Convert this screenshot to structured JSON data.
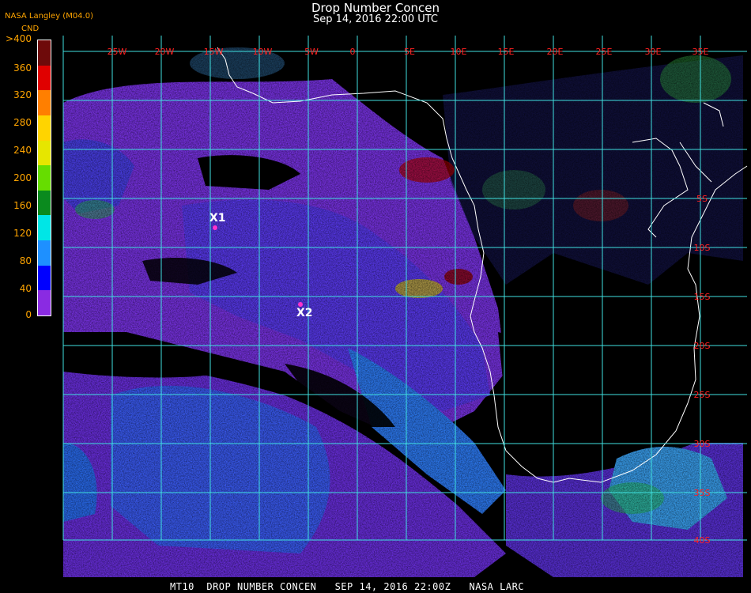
{
  "header": {
    "title": "Drop Number Concen",
    "datetime": "Sep 14, 2016 22:00 UTC",
    "producer": "NASA Langley (M04.0)"
  },
  "colorbar": {
    "units": "CND",
    "labels": [
      ">400",
      "360",
      "320",
      "280",
      "240",
      "200",
      "160",
      "120",
      "80",
      "40",
      "0"
    ],
    "colors": [
      "#6e0a0a",
      "#e00000",
      "#ff7f00",
      "#ffd400",
      "#e6e600",
      "#66dd00",
      "#0a8a1e",
      "#00e6e6",
      "#1e90ff",
      "#0000ff",
      "#8a2be2"
    ]
  },
  "map": {
    "grid_color": "#40e0e0",
    "coast_color": "#ffffff",
    "label_color": "#ff2020",
    "lon_labels": [
      "25W",
      "20W",
      "15W",
      "10W",
      "5W",
      "0",
      "5E",
      "10E",
      "15E",
      "20E",
      "25E",
      "30E",
      "35E"
    ],
    "lat_labels": [
      "5S",
      "10S",
      "15S",
      "20S",
      "25S",
      "30S",
      "35S",
      "40S"
    ],
    "markers": [
      {
        "label": "X1",
        "color": "#ff33cc"
      },
      {
        "label": "X2",
        "color": "#ff33cc"
      }
    ]
  },
  "footer": {
    "text": "MT10  DROP NUMBER CONCEN   SEP 14, 2016 22:00Z   NASA LARC"
  }
}
